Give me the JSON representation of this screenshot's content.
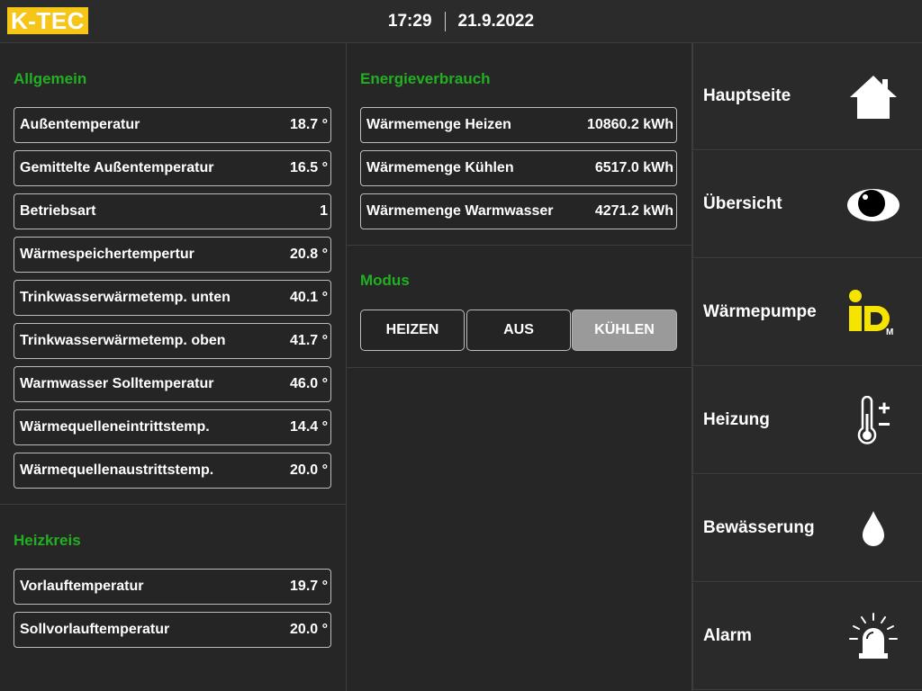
{
  "header": {
    "logo": "K-TEC",
    "time": "17:29",
    "date": "21.9.2022"
  },
  "allgemein": {
    "title": "Allgemein",
    "rows": [
      {
        "label": "Außentemperatur",
        "value": "18.7 °"
      },
      {
        "label": "Gemittelte Außentemperatur",
        "value": "16.5 °"
      },
      {
        "label": "Betriebsart",
        "value": "1"
      },
      {
        "label": "Wärmespeichertempertur",
        "value": "20.8 °"
      },
      {
        "label": "Trinkwasserwärmetemp. unten",
        "value": "40.1 °"
      },
      {
        "label": "Trinkwasserwärmetemp. oben",
        "value": "41.7 °"
      },
      {
        "label": "Warmwasser Solltemperatur",
        "value": "46.0 °"
      },
      {
        "label": "Wärmequelleneintrittstemp.",
        "value": "14.4 °"
      },
      {
        "label": "Wärmequellenaustrittstemp.",
        "value": "20.0 °"
      }
    ]
  },
  "heizkreis": {
    "title": "Heizkreis",
    "rows": [
      {
        "label": "Vorlauftemperatur",
        "value": "19.7 °"
      },
      {
        "label": "Sollvorlauftemperatur",
        "value": "20.0 °"
      }
    ]
  },
  "energie": {
    "title": "Energieverbrauch",
    "rows": [
      {
        "label": "Wärmemenge Heizen",
        "value": "10860.2 kWh"
      },
      {
        "label": "Wärmemenge Kühlen",
        "value": "6517.0 kWh"
      },
      {
        "label": "Wärmemenge Warmwasser",
        "value": "4271.2 kWh"
      }
    ]
  },
  "modus": {
    "title": "Modus",
    "buttons": [
      "HEIZEN",
      "AUS",
      "KÜHLEN"
    ],
    "selected": "KÜHLEN"
  },
  "nav": {
    "items": [
      {
        "label": "Hauptseite",
        "icon": "home-icon"
      },
      {
        "label": "Übersicht",
        "icon": "eye-icon"
      },
      {
        "label": "Wärmepumpe",
        "icon": "id-logo-icon"
      },
      {
        "label": "Heizung",
        "icon": "thermometer-icon"
      },
      {
        "label": "Bewässerung",
        "icon": "water-drop-icon"
      },
      {
        "label": "Alarm",
        "icon": "alarm-light-icon"
      }
    ]
  },
  "colors": {
    "section_title": "#21b021",
    "logo_bg": "#f5c518",
    "background": "#262626",
    "active_button": "#9a9a9a"
  }
}
